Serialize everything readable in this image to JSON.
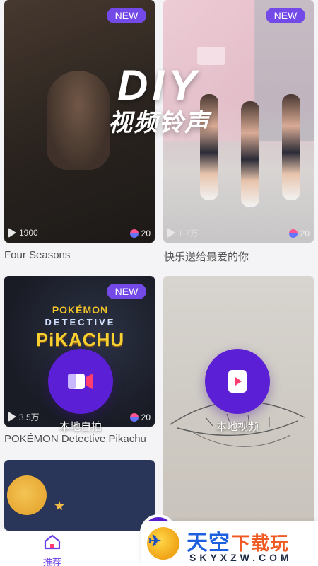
{
  "feed": {
    "cards": [
      {
        "badge": "NEW",
        "views": "1900",
        "ringtones": "20",
        "title": "Four Seasons"
      },
      {
        "badge": "NEW",
        "views": "1.7万",
        "ringtones": "20",
        "title": "快乐送给最爱的你"
      },
      {
        "badge": "NEW",
        "views": "3.5万",
        "ringtones": "20",
        "title": "POKÉMON Detective Pikachu"
      }
    ],
    "pikachu_logo": {
      "top": "POKÉMON",
      "middle": "DETECTIVE",
      "big": "PiKACHU"
    }
  },
  "overlay": {
    "headline": "DIY",
    "subheadline": "视频铃声",
    "actions": [
      {
        "label": "本地自拍",
        "icon": "video-camera-icon"
      },
      {
        "label": "本地视频",
        "icon": "video-file-icon"
      }
    ]
  },
  "bottom_nav": {
    "home_label": "推荐",
    "accent": "#6b3ee6"
  },
  "watermark": {
    "brand_cn_a": "天空",
    "brand_cn_b": "下载玩",
    "domain": "SKYXZW.COM"
  },
  "colors": {
    "primary": "#5b1fd6",
    "badge": "#6b3ee6"
  }
}
